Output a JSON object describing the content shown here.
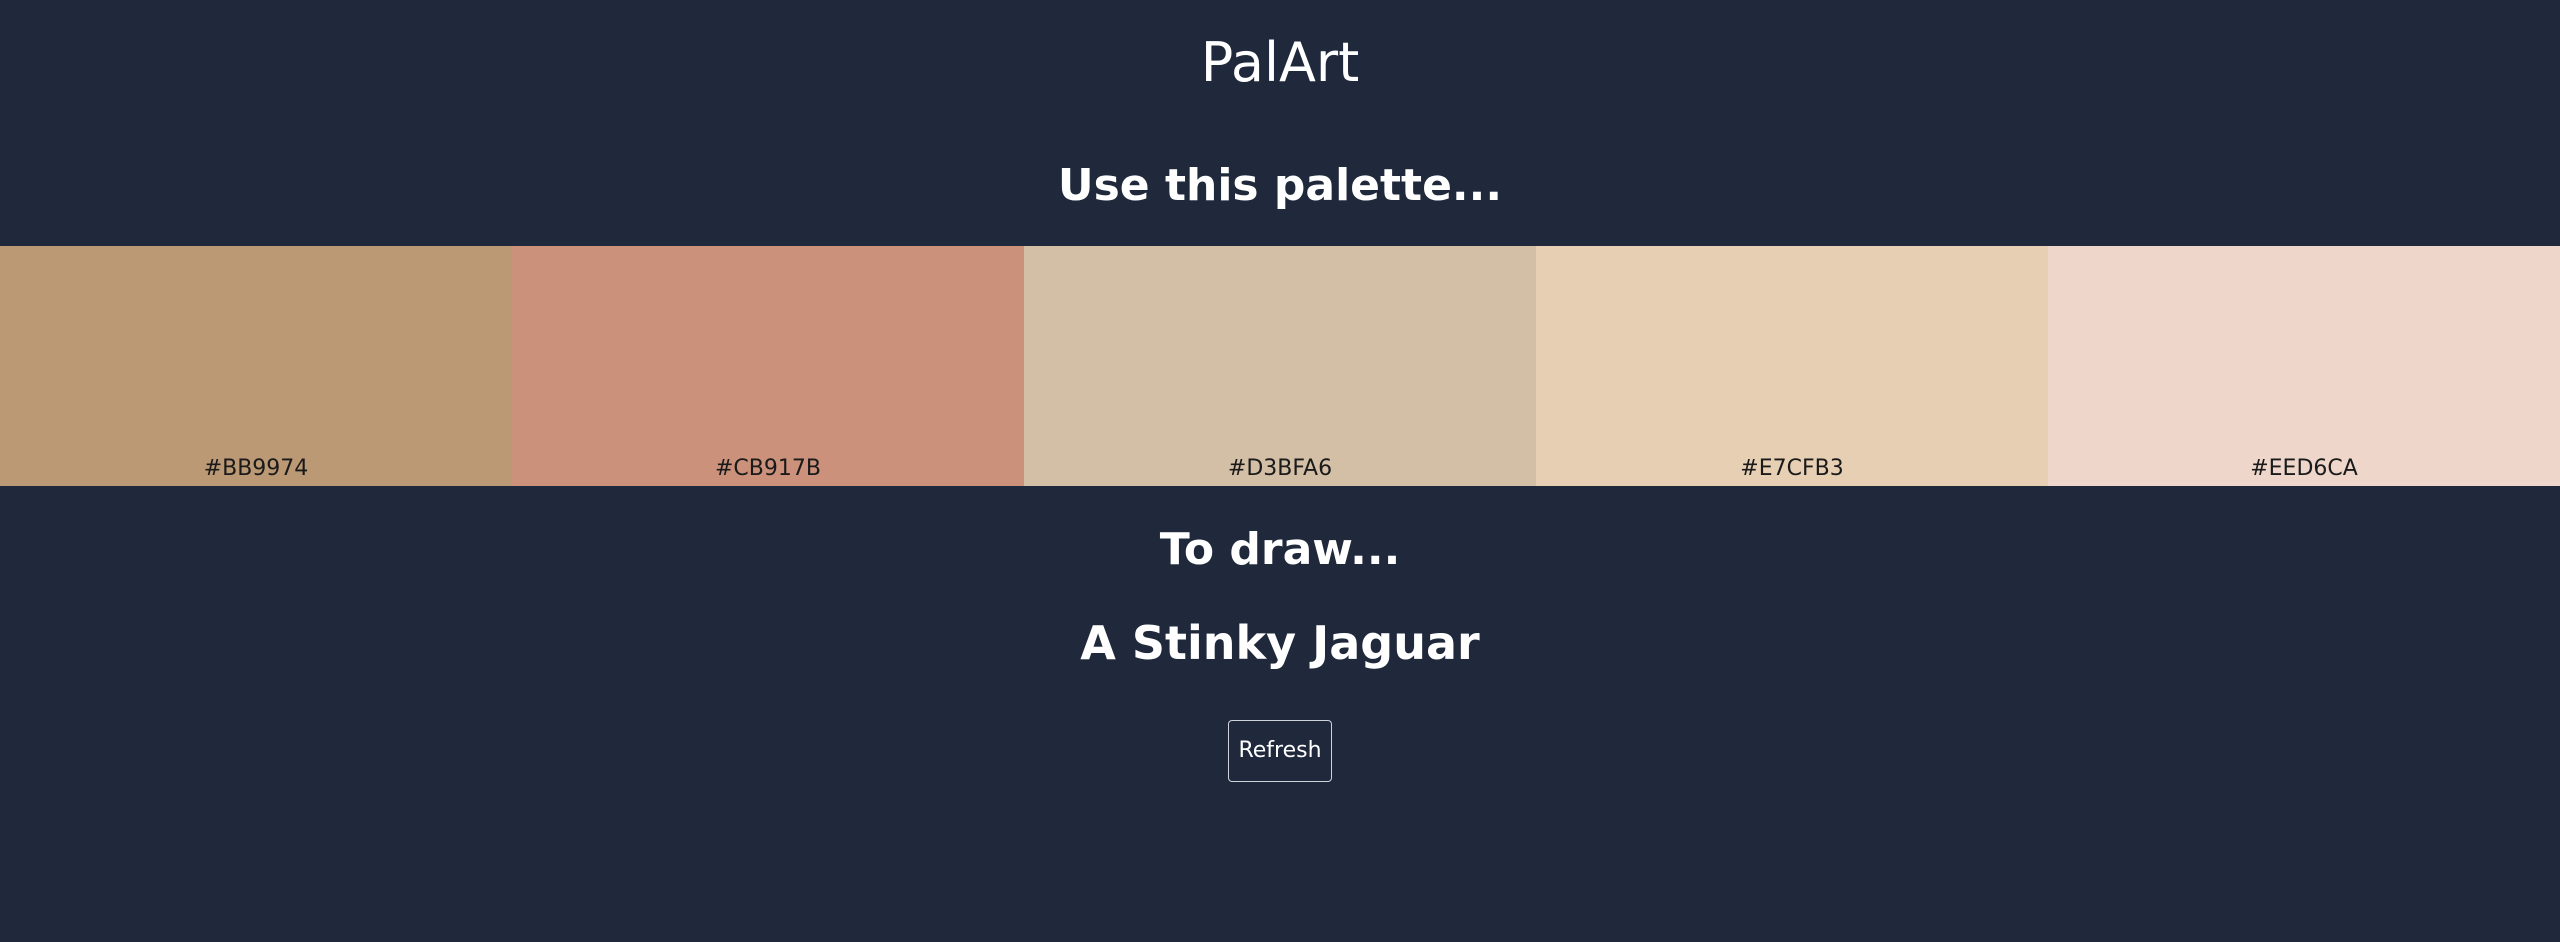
{
  "app": {
    "title": "PalArt"
  },
  "palette_section": {
    "heading": "Use this palette...",
    "swatches": [
      {
        "label": "#BB9974",
        "color": "#BB9974"
      },
      {
        "label": "#CB917B",
        "color": "#CB917B"
      },
      {
        "label": "#D3BFA6",
        "color": "#D3BFA6"
      },
      {
        "label": "#E7CFB3",
        "color": "#E7CFB3"
      },
      {
        "label": "#EED6CA",
        "color": "#EED6CA"
      }
    ]
  },
  "draw_section": {
    "heading": "To draw...",
    "prompt": "A Stinky Jaguar"
  },
  "actions": {
    "refresh_label": "Refresh"
  },
  "theme": {
    "background": "#1F293B",
    "text": "#FFFFFF"
  }
}
